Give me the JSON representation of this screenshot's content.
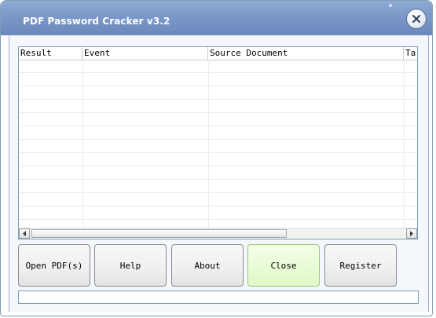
{
  "window": {
    "title": "PDF Password Cracker v3.2",
    "close_icon": "close-icon"
  },
  "table": {
    "columns": [
      "Result",
      "Event",
      "Source Document",
      "Ta"
    ],
    "rows": []
  },
  "buttons": {
    "open_label": "Open PDF(s)",
    "help_label": "Help",
    "about_label": "About",
    "close_label": "Close",
    "register_label": "Register"
  },
  "progress": {
    "value": 0
  },
  "colors": {
    "titlebar": "#7b98c8",
    "border": "#7f9db9",
    "active_button": "#e2f7c9"
  }
}
